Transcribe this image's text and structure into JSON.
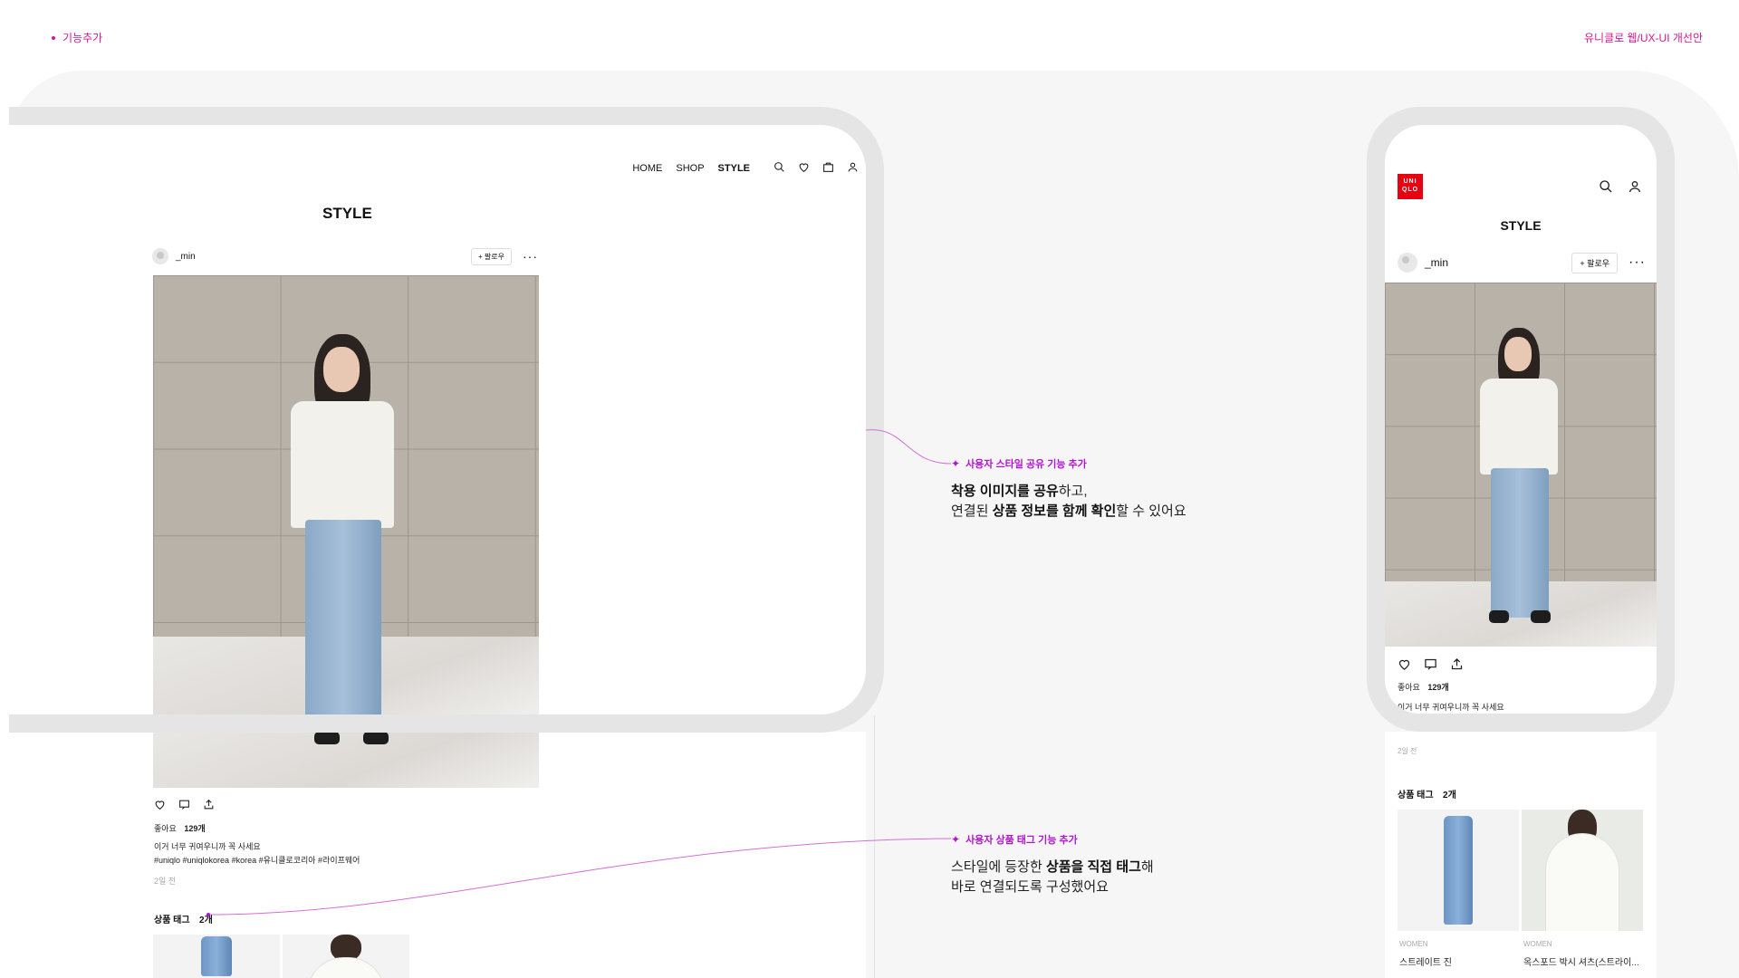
{
  "header": {
    "section_tag": "기능추가",
    "project_title": "유니클로 웹/UX-UI 개선안"
  },
  "colors": {
    "accent_pink": "#d1198f",
    "accent_purple": "#b215d1",
    "brand_red": "#e60012",
    "stage_bg": "#f6f6f6"
  },
  "desktop": {
    "nav": {
      "home": "HOME",
      "shop": "SHOP",
      "style": "STYLE"
    },
    "icons": [
      "search-icon",
      "heart-icon",
      "bag-icon",
      "user-icon"
    ],
    "page_title": "STYLE",
    "post": {
      "username": "_min",
      "follow_label": "+ 팔로우",
      "more_label": "···",
      "likes_label": "좋아요",
      "likes_count": "129개",
      "caption": "이거 너무 귀여우니까 꼭 사세요",
      "hashtags": "#uniqlo #uniqlokorea #korea #유니클로코리아 #라이프웨어",
      "time": "2일 전"
    },
    "tags": {
      "label": "상품 태그",
      "count": "2개"
    }
  },
  "mobile": {
    "logo_line1": "UNI",
    "logo_line2": "QLO",
    "page_title": "STYLE",
    "post": {
      "username": "_min",
      "follow_label": "+ 팔로우",
      "more_label": "···",
      "likes_label": "좋아요",
      "likes_count": "129개",
      "caption": "이거 너무 귀여우니까 꼭 사세요",
      "time": "2일 전"
    },
    "tags": {
      "label": "상품 태그",
      "count": "2개"
    },
    "products": [
      {
        "category": "WOMEN",
        "name": "스트레이트 진"
      },
      {
        "category": "WOMEN",
        "name": "옥스포드 박시 셔츠(스트라이..."
      }
    ]
  },
  "annotations": [
    {
      "title": "사용자 스타일 공유 기능 추가",
      "line1_b1": "착용 이미지를 공유",
      "line1_t1": "하고,",
      "line2_t1": "연결된 ",
      "line2_b1": "상품 정보를 함께 확인",
      "line2_t2": "할 수 있어요"
    },
    {
      "title": "사용자 상품 태그 기능 추가",
      "line1_t1": "스타일에 등장한 ",
      "line1_b1": "상품을 직접 태그",
      "line1_t2": "해",
      "line2_t1": "바로 연결되도록 구성했어요"
    }
  ]
}
